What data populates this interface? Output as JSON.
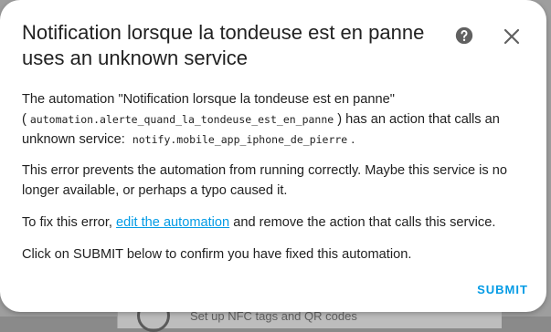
{
  "background": {
    "card_text": "Set up NFC tags and QR codes"
  },
  "dialog": {
    "title": "Notification lorsque la tondeuse est en panne uses an unknown service",
    "help_icon": "help-circle-icon",
    "close_icon": "close-icon",
    "p1": {
      "prefix": "The automation \"Notification lorsque la tondeuse est en panne\" (",
      "automation_id": "automation.alerte_quand_la_tondeuse_est_en_panne",
      "middle": ") has an action that calls an unknown service:",
      "service": "notify.mobile_app_iphone_de_pierre",
      "suffix": "."
    },
    "p2": "This error prevents the automation from running correctly. Maybe this service is no longer available, or perhaps a typo caused it.",
    "p3": {
      "prefix": "To fix this error,",
      "link": "edit the automation",
      "suffix": "and remove the action that calls this service."
    },
    "p4": "Click on SUBMIT below to confirm you have fixed this automation.",
    "submit_label": "SUBMIT"
  },
  "colors": {
    "accent": "#039be5",
    "text": "#212121",
    "icon": "#616161"
  }
}
